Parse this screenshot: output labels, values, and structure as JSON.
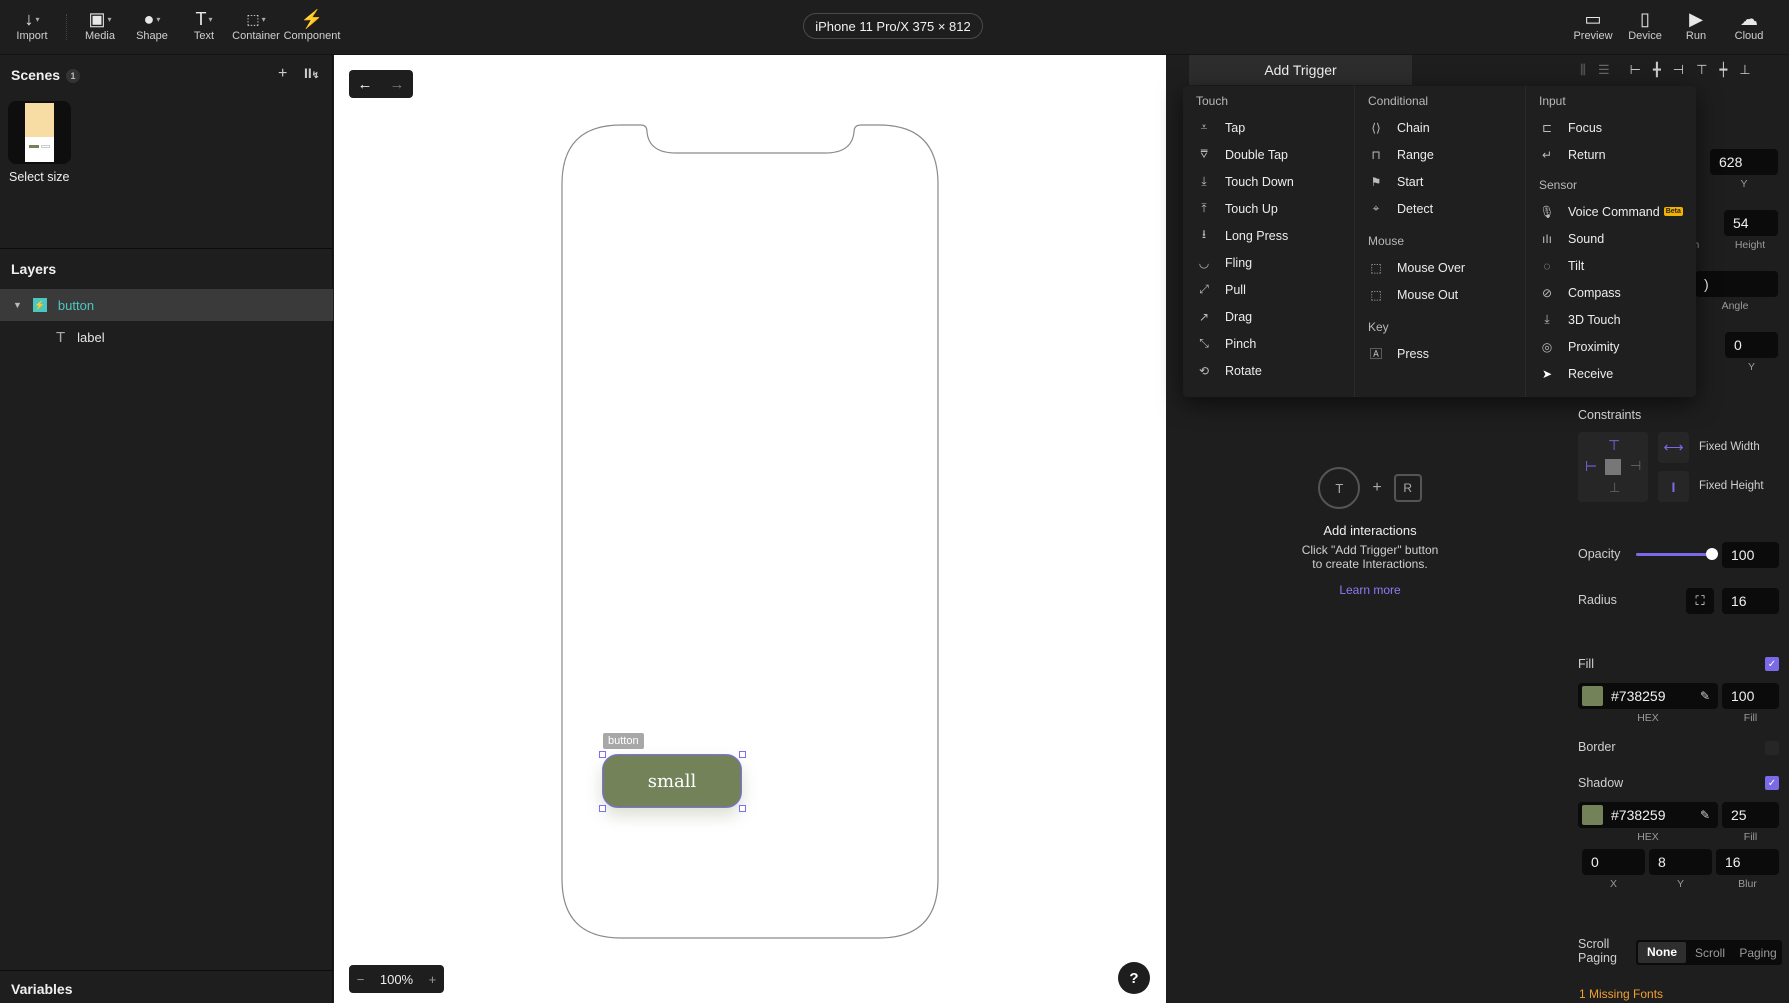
{
  "toolbar": {
    "left": [
      {
        "label": "Import",
        "icon": "import-arrow-icon"
      },
      {
        "label": "Media",
        "icon": "image-icon"
      },
      {
        "label": "Shape",
        "icon": "shape-icon"
      },
      {
        "label": "Text",
        "icon": "text-icon"
      },
      {
        "label": "Container",
        "icon": "container-icon"
      },
      {
        "label": "Component",
        "icon": "lightning-icon"
      }
    ],
    "device": "iPhone 11 Pro/X  375 × 812",
    "right": [
      {
        "label": "Preview",
        "icon": "monitor-icon"
      },
      {
        "label": "Device",
        "icon": "phone-icon"
      },
      {
        "label": "Run",
        "icon": "play-icon"
      },
      {
        "label": "Cloud",
        "icon": "cloud-icon"
      }
    ]
  },
  "scenes": {
    "title": "Scenes",
    "count": "1",
    "items": [
      {
        "label": "Select size"
      }
    ]
  },
  "layers": {
    "title": "Layers",
    "items": [
      {
        "label": "button",
        "type": "component",
        "selected": true
      },
      {
        "label": "label",
        "type": "text"
      }
    ]
  },
  "variables": {
    "title": "Variables"
  },
  "canvas": {
    "zoom": "100%",
    "help": "?",
    "element_tag": "button",
    "button_text": "small",
    "button_color": "#738259",
    "selection_color": "#7f6ff0"
  },
  "trigger": {
    "button_label": "Add Trigger",
    "columns": [
      {
        "groups": [
          {
            "title": "Touch",
            "items": [
              "Tap",
              "Double Tap",
              "Touch Down",
              "Touch Up",
              "Long Press",
              "Fling",
              "Pull",
              "Drag",
              "Pinch",
              "Rotate"
            ]
          }
        ]
      },
      {
        "groups": [
          {
            "title": "Conditional",
            "items": [
              "Chain",
              "Range",
              "Start",
              "Detect"
            ]
          },
          {
            "title": "Mouse",
            "items": [
              "Mouse Over",
              "Mouse Out"
            ]
          },
          {
            "title": "Key",
            "items": [
              "Press"
            ]
          }
        ]
      },
      {
        "groups": [
          {
            "title": "Input",
            "items": [
              "Focus",
              "Return"
            ]
          },
          {
            "title": "Sensor",
            "items": [
              "Voice Command",
              "Sound",
              "Tilt",
              "Compass",
              "3D Touch",
              "Proximity",
              "Receive"
            ]
          }
        ]
      }
    ],
    "beta_label": "Beta"
  },
  "empty_state": {
    "trigger_letter": "T",
    "response_letter": "R",
    "plus": "+",
    "title": "Add interactions",
    "desc_line1": "Click \"Add Trigger\" button",
    "desc_line2": "to create Interactions.",
    "link": "Learn more"
  },
  "properties": {
    "y": {
      "value": "628",
      "label": "Y"
    },
    "width_label": "th",
    "height": {
      "value": "54",
      "label": "Height"
    },
    "angle": {
      "value": ")",
      "label": "Angle"
    },
    "offset_y": {
      "value": "0",
      "label": "Y"
    },
    "constraints": {
      "title": "Constraints",
      "fixed_width": "Fixed Width",
      "fixed_height": "Fixed Height"
    },
    "opacity": {
      "label": "Opacity",
      "value": "100",
      "fraction": 1.0
    },
    "radius": {
      "label": "Radius",
      "value": "16"
    },
    "fill": {
      "label": "Fill",
      "checked": true,
      "hex": "#738259",
      "hex_label": "HEX",
      "amount": "100",
      "amount_label": "Fill"
    },
    "border": {
      "label": "Border"
    },
    "shadow": {
      "label": "Shadow",
      "checked": true,
      "hex": "#738259",
      "hex_label": "HEX",
      "amount": "25",
      "amount_label": "Fill",
      "x": "0",
      "y": "8",
      "blur": "16",
      "x_label": "X",
      "y_label": "Y",
      "blur_label": "Blur"
    },
    "scroll": {
      "label_line1": "Scroll",
      "label_line2": "Paging",
      "options": [
        "None",
        "Scroll",
        "Paging"
      ],
      "selected": "None"
    },
    "missing_fonts": "1 Missing Fonts"
  }
}
